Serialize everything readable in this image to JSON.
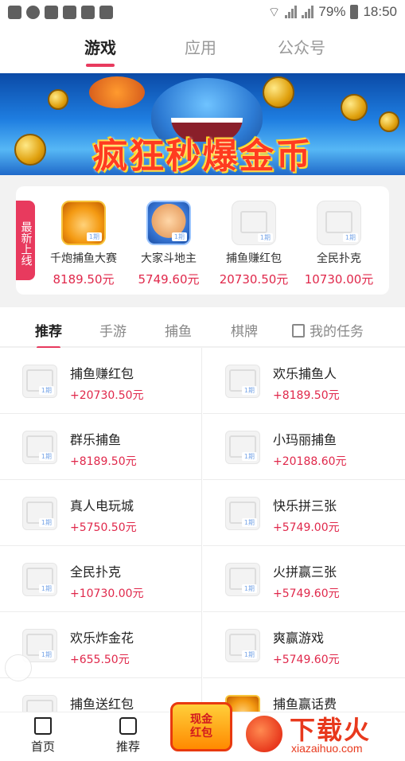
{
  "status": {
    "battery": "79%",
    "time": "18:50",
    "net1": "3G",
    "net2": "4G"
  },
  "top_tabs": [
    {
      "label": "游戏",
      "active": true
    },
    {
      "label": "应用",
      "active": false
    },
    {
      "label": "公众号",
      "active": false
    }
  ],
  "banner": {
    "title": "疯狂秒爆金币"
  },
  "newest": {
    "tag": "最新上线",
    "games": [
      {
        "name": "千炮捕鱼大赛",
        "amount": "8189.50元",
        "icon": "fish-game-icon",
        "badge": "1期"
      },
      {
        "name": "大家斗地主",
        "amount": "5749.60元",
        "icon": "landlord-game-icon",
        "badge": "1期"
      },
      {
        "name": "捕鱼赚红包",
        "amount": "20730.50元",
        "icon": "image-placeholder-icon",
        "badge": "1期"
      },
      {
        "name": "全民扑克",
        "amount": "10730.00元",
        "icon": "image-placeholder-icon",
        "badge": "1期"
      }
    ]
  },
  "sub_tabs": [
    {
      "label": "推荐",
      "active": true
    },
    {
      "label": "手游",
      "active": false
    },
    {
      "label": "捕鱼",
      "active": false
    },
    {
      "label": "棋牌",
      "active": false
    },
    {
      "label": "我的任务",
      "active": false
    }
  ],
  "games": [
    {
      "name": "捕鱼赚红包",
      "amount": "+20730.50元",
      "badge": "1期"
    },
    {
      "name": "欢乐捕鱼人",
      "amount": "+8189.50元",
      "badge": "1期"
    },
    {
      "name": "群乐捕鱼",
      "amount": "+8189.50元",
      "badge": "1期"
    },
    {
      "name": "小玛丽捕鱼",
      "amount": "+20188.60元",
      "badge": "1期"
    },
    {
      "name": "真人电玩城",
      "amount": "+5750.50元",
      "badge": "1期"
    },
    {
      "name": "快乐拼三张",
      "amount": "+5749.00元",
      "badge": "1期"
    },
    {
      "name": "全民扑克",
      "amount": "+10730.00元",
      "badge": "1期"
    },
    {
      "name": "火拼赢三张",
      "amount": "+5749.60元",
      "badge": "1期"
    },
    {
      "name": "欢乐炸金花",
      "amount": "+655.50元",
      "badge": "1期"
    },
    {
      "name": "爽赢游戏",
      "amount": "+5749.60元",
      "badge": "1期"
    },
    {
      "name": "捕鱼送红包",
      "amount": "",
      "badge": "1期"
    },
    {
      "name": "捕鱼赢话费",
      "amount": "",
      "badge": ""
    }
  ],
  "bottom_nav": [
    {
      "label": "首页",
      "icon": "home-icon"
    },
    {
      "label": "推荐",
      "icon": "recommend-icon"
    }
  ],
  "red_packet": {
    "line1": "现金",
    "line2": "红包"
  },
  "watermark": {
    "brand": "下载火",
    "url": "xiazaihuo.com"
  }
}
